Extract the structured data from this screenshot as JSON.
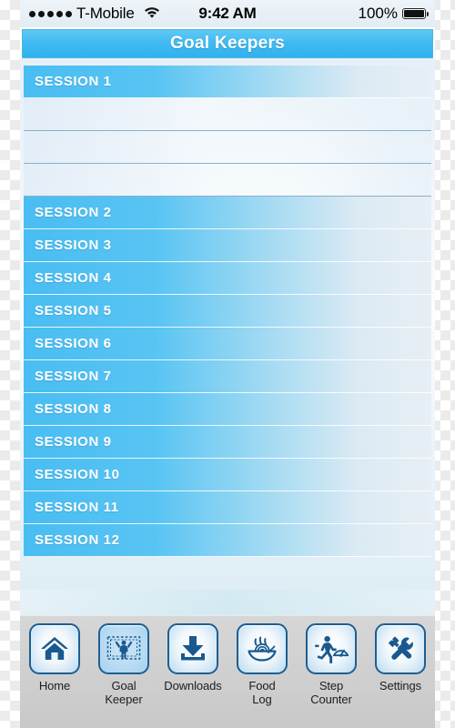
{
  "status_bar": {
    "signal_dots": 5,
    "carrier": "T-Mobile",
    "wifi_icon": "wifi-icon",
    "time": "9:42 AM",
    "battery_percent": "100%",
    "battery_icon": "battery-full-icon"
  },
  "navbar": {
    "title": "Goal Keepers",
    "color": "#3fb9f0"
  },
  "sessions": [
    {
      "label": "SESSION 1",
      "expanded": true,
      "subrows": 3
    },
    {
      "label": "SESSION 2",
      "expanded": false,
      "subrows": 0
    },
    {
      "label": "SESSION 3",
      "expanded": false,
      "subrows": 0
    },
    {
      "label": "SESSION 4",
      "expanded": false,
      "subrows": 0
    },
    {
      "label": "SESSION 5",
      "expanded": false,
      "subrows": 0
    },
    {
      "label": "SESSION 6",
      "expanded": false,
      "subrows": 0
    },
    {
      "label": "SESSION 7",
      "expanded": false,
      "subrows": 0
    },
    {
      "label": "SESSION 8",
      "expanded": false,
      "subrows": 0
    },
    {
      "label": "SESSION 9",
      "expanded": false,
      "subrows": 0
    },
    {
      "label": "SESSION 10",
      "expanded": false,
      "subrows": 0
    },
    {
      "label": "SESSION 11",
      "expanded": false,
      "subrows": 0
    },
    {
      "label": "SESSION 12",
      "expanded": false,
      "subrows": 0
    }
  ],
  "tabbar": {
    "accent": "#1c5f93",
    "items": [
      {
        "label": "Home",
        "icon": "home-icon",
        "selected": false
      },
      {
        "label": "Goal\nKeeper",
        "icon": "goal-keeper-icon",
        "selected": true
      },
      {
        "label": "Downloads",
        "icon": "download-icon",
        "selected": false
      },
      {
        "label": "Food\nLog",
        "icon": "food-bowl-icon",
        "selected": false
      },
      {
        "label": "Step\nCounter",
        "icon": "runner-gauge-icon",
        "selected": false
      },
      {
        "label": "Settings",
        "icon": "tools-icon",
        "selected": false
      }
    ]
  }
}
